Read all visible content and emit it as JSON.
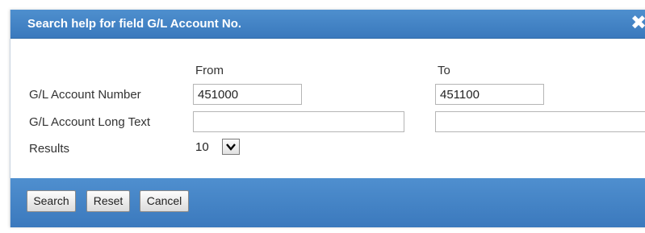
{
  "dialog": {
    "title": "Search help for field G/L Account No.",
    "close_icon": "close-icon"
  },
  "form": {
    "from_header": "From",
    "to_header": "To",
    "rows": [
      {
        "label": "G/L Account Number",
        "from_value": "451000",
        "to_value": "451100"
      },
      {
        "label": "G/L Account Long Text",
        "from_value": "",
        "to_value": ""
      }
    ],
    "results": {
      "label": "Results",
      "value": "10",
      "dropdown_icon": "chevron-down-icon"
    }
  },
  "footer": {
    "search_label": "Search",
    "reset_label": "Reset",
    "cancel_label": "Cancel"
  },
  "colors": {
    "title_bar": "#3f7fc2",
    "footer_bar": "#3f7fc2",
    "title_text": "#ffffff"
  }
}
